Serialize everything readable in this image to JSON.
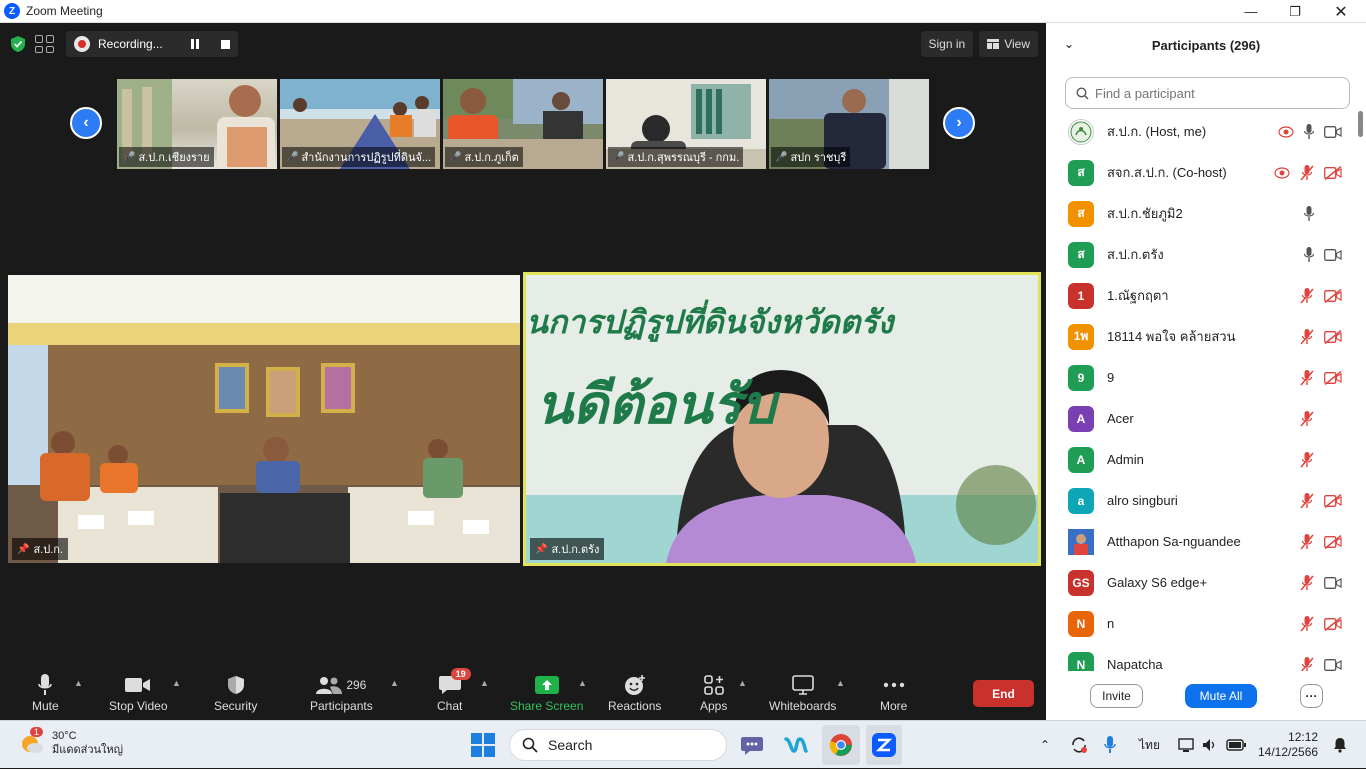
{
  "window": {
    "title": "Zoom Meeting"
  },
  "topbar": {
    "recording_label": "Recording...",
    "signin_label": "Sign in",
    "view_label": "View"
  },
  "gallery": {
    "thumbnails": [
      {
        "name": "ส.ป.ก.เชียงราย"
      },
      {
        "name": "สำนักงานการปฏิรูปที่ดินจั..."
      },
      {
        "name": "ส.ป.ก.ภูเก็ต"
      },
      {
        "name": "ส.ป.ก.สุพรรณบุรี - กกม."
      },
      {
        "name": "สปก ราชบุรี"
      }
    ],
    "main_tiles": [
      {
        "name": "ส.ป.ก."
      },
      {
        "name": "ส.ป.ก.ตรัง"
      }
    ],
    "banner_line1": "นการปฏิรูปที่ดินจังหวัดตรัง",
    "banner_line2": "นดีต้อนรับ"
  },
  "toolbar": {
    "mute": "Mute",
    "stop_video": "Stop Video",
    "security": "Security",
    "participants": "Participants",
    "participants_count": "296",
    "chat": "Chat",
    "chat_badge": "19",
    "share_screen": "Share Screen",
    "reactions": "Reactions",
    "apps": "Apps",
    "whiteboards": "Whiteboards",
    "more": "More",
    "end": "End"
  },
  "panel": {
    "title": "Participants (296)",
    "search_placeholder": "Find a participant",
    "invite": "Invite",
    "mute_all": "Mute All",
    "more_label": "···",
    "participants": [
      {
        "name": "ส.ป.ก. (Host, me)",
        "avatar": "",
        "color": "#ffffff",
        "rec": true,
        "mic": "on",
        "cam": "on",
        "logo": true
      },
      {
        "name": "สจก.ส.ป.ก. (Co-host)",
        "avatar": "ส",
        "color": "#1f9d55",
        "rec": true,
        "mic": "off",
        "cam": "off"
      },
      {
        "name": "ส.ป.ก.ชัยภูมิ2",
        "avatar": "ส",
        "color": "#f29100",
        "mic": "on",
        "cam": "none"
      },
      {
        "name": "ส.ป.ก.ตรัง",
        "avatar": "ส",
        "color": "#1f9d55",
        "mic": "on",
        "cam": "on"
      },
      {
        "name": "1.ณัฐกฤตา",
        "avatar": "1",
        "color": "#c9312d",
        "mic": "off",
        "cam": "off"
      },
      {
        "name": "18114 พอใจ คล้ายสวน",
        "avatar": "1พ",
        "color": "#f29100",
        "mic": "off",
        "cam": "off"
      },
      {
        "name": "9",
        "avatar": "9",
        "color": "#1f9d55",
        "mic": "off",
        "cam": "off"
      },
      {
        "name": "Acer",
        "avatar": "A",
        "color": "#7b3fb4",
        "mic": "off",
        "cam": "none"
      },
      {
        "name": "Admin",
        "avatar": "A",
        "color": "#1f9d55",
        "mic": "off",
        "cam": "none"
      },
      {
        "name": "alro singburi",
        "avatar": "a",
        "color": "#0ea5b7",
        "mic": "off",
        "cam": "off"
      },
      {
        "name": "Atthapon Sa-nguandee",
        "avatar": "",
        "color": "#3a6fc7",
        "mic": "off",
        "cam": "off",
        "photo": true
      },
      {
        "name": "Galaxy S6 edge+",
        "avatar": "GS",
        "color": "#c9312d",
        "mic": "off",
        "cam": "on"
      },
      {
        "name": "n",
        "avatar": "N",
        "color": "#e8650a",
        "mic": "off",
        "cam": "off"
      },
      {
        "name": "Napatcha",
        "avatar": "N",
        "color": "#1f9d55",
        "mic": "off",
        "cam": "on"
      }
    ]
  },
  "taskbar": {
    "temp": "30°C",
    "weather_desc": "มีแดดส่วนใหญ่",
    "weather_badge": "1",
    "search_label": "Search",
    "lang": "ไทย",
    "time": "12:12",
    "date": "14/12/2566"
  }
}
